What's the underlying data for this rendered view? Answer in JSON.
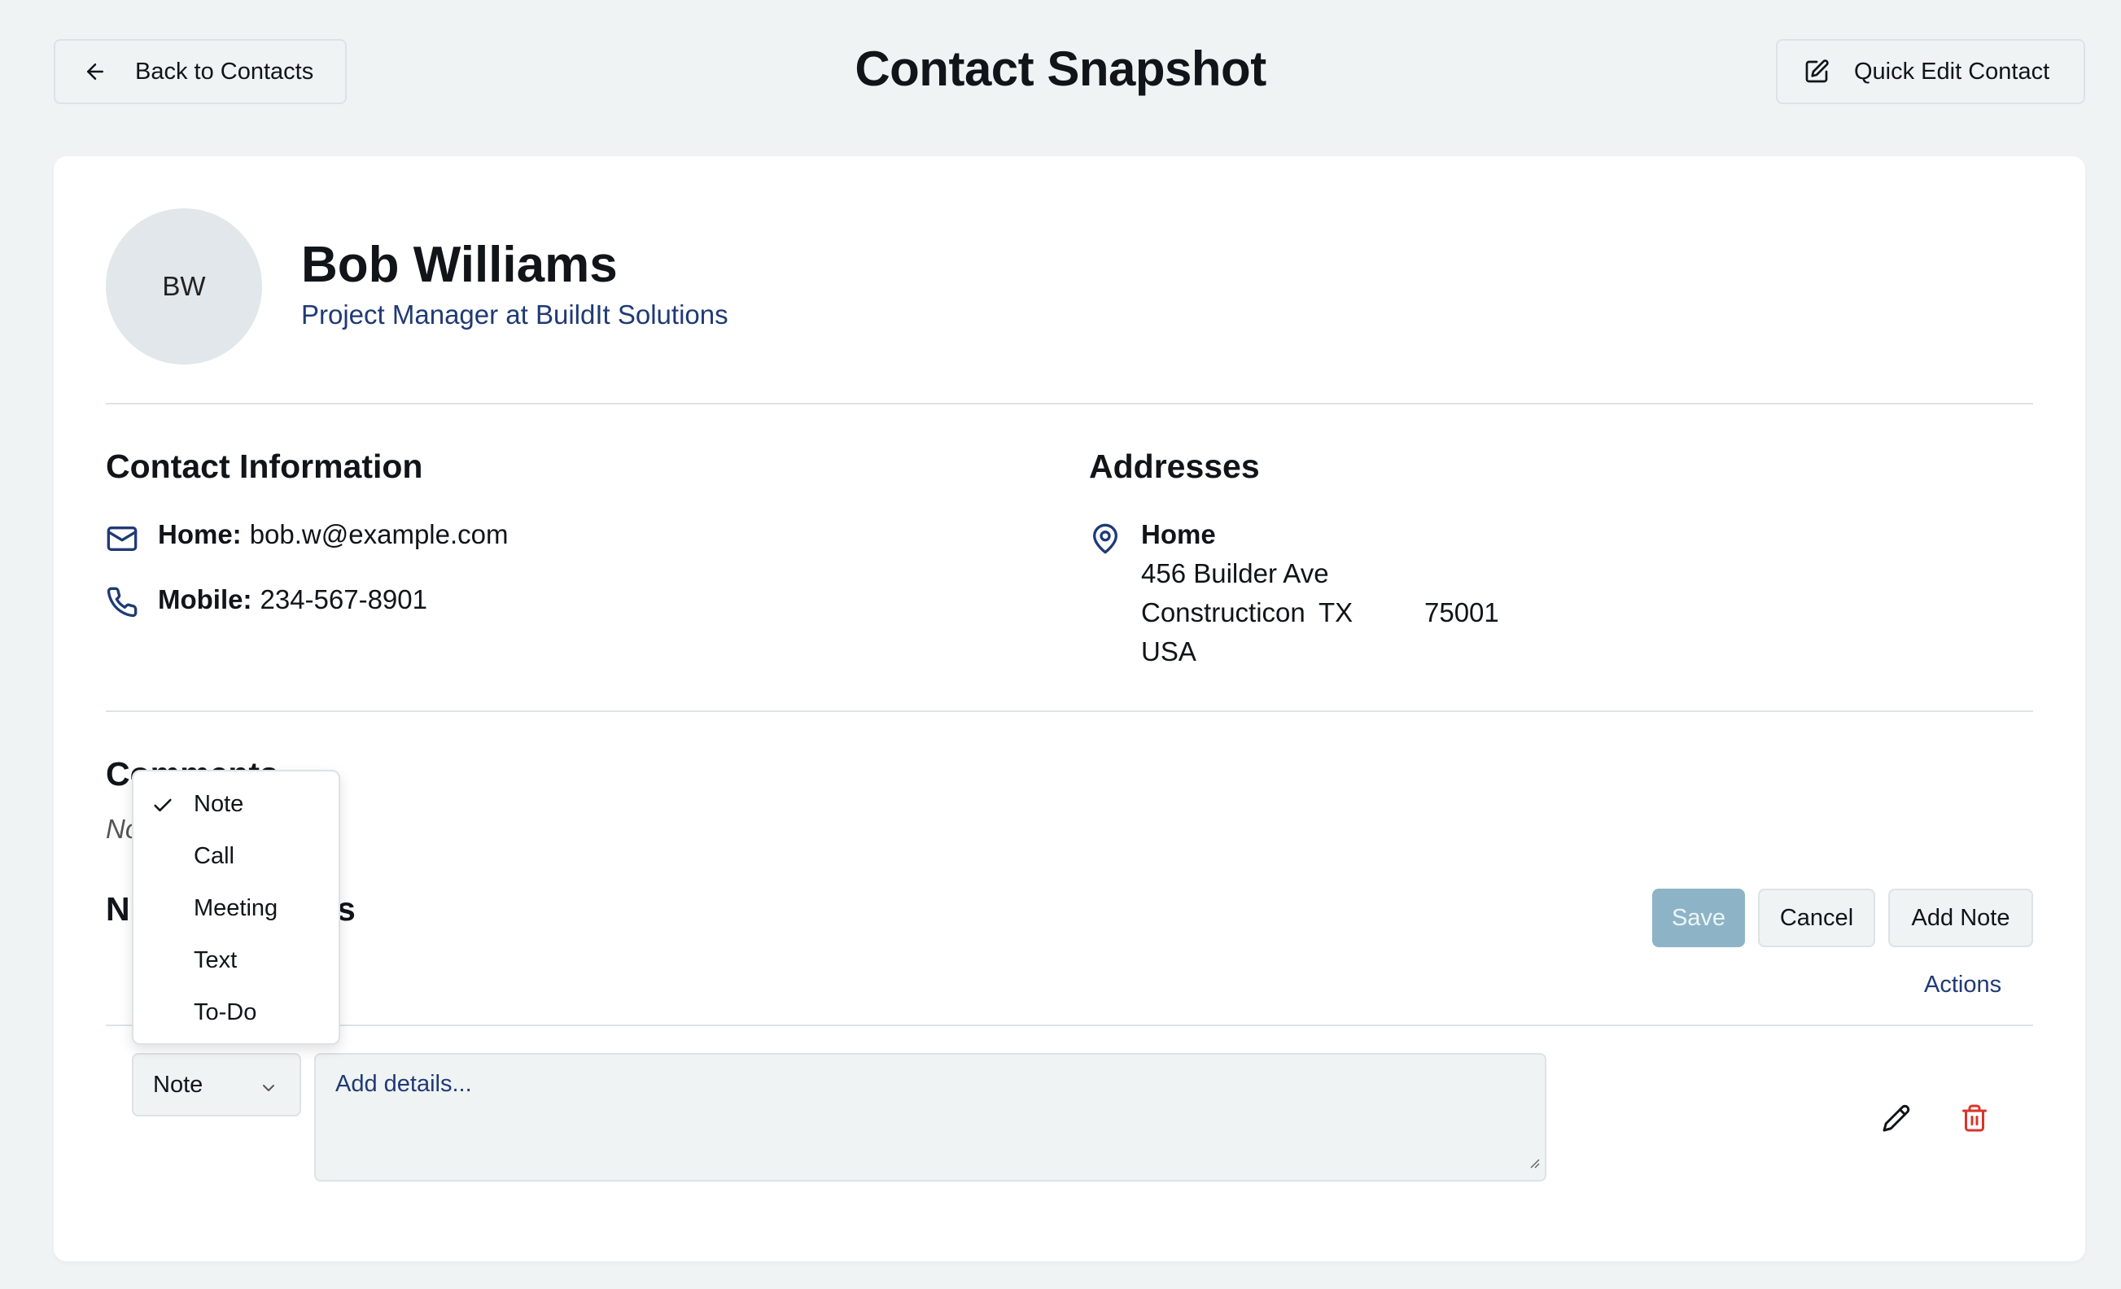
{
  "header": {
    "back_label": "Back to Contacts",
    "title": "Contact Snapshot",
    "quick_edit_label": "Quick Edit Contact"
  },
  "contact": {
    "initials": "BW",
    "name": "Bob Williams",
    "role": "Project Manager at BuildIt Solutions"
  },
  "contact_info": {
    "heading": "Contact Information",
    "email_label": "Home:",
    "email_value": "bob.w@example.com",
    "phone_label": "Mobile:",
    "phone_value": "234-567-8901"
  },
  "addresses": {
    "heading": "Addresses",
    "type": "Home",
    "street": "456 Builder Ave",
    "city": "Constructicon",
    "state": "TX",
    "zip": "75001",
    "country": "USA"
  },
  "comments": {
    "heading_visible_start": "Co",
    "heading_visible_end": "mments",
    "placeholder_visible": "No"
  },
  "notes": {
    "heading_visible_start": "N",
    "heading_visible_end": "s",
    "save_label": "Save",
    "cancel_label": "Cancel",
    "add_note_label": "Add Note",
    "actions_header": "Actions",
    "type_value": "Note",
    "details_placeholder": "Add details..."
  },
  "type_dropdown": {
    "options": [
      "Note",
      "Call",
      "Meeting",
      "Text",
      "To-Do"
    ],
    "selected": "Note"
  },
  "colors": {
    "background": "#f0f3f4",
    "accent_text": "#1f3a75",
    "save_disabled": "#8db4c6",
    "delete_red": "#d9342b"
  },
  "icons": {
    "back": "arrow-left-icon",
    "quick_edit": "edit-square-icon",
    "email": "mail-icon",
    "phone": "phone-icon",
    "address": "map-pin-icon",
    "edit_row": "pencil-icon",
    "delete_row": "trash-icon",
    "select_chevron": "chevron-down-icon",
    "selected_check": "check-icon"
  }
}
